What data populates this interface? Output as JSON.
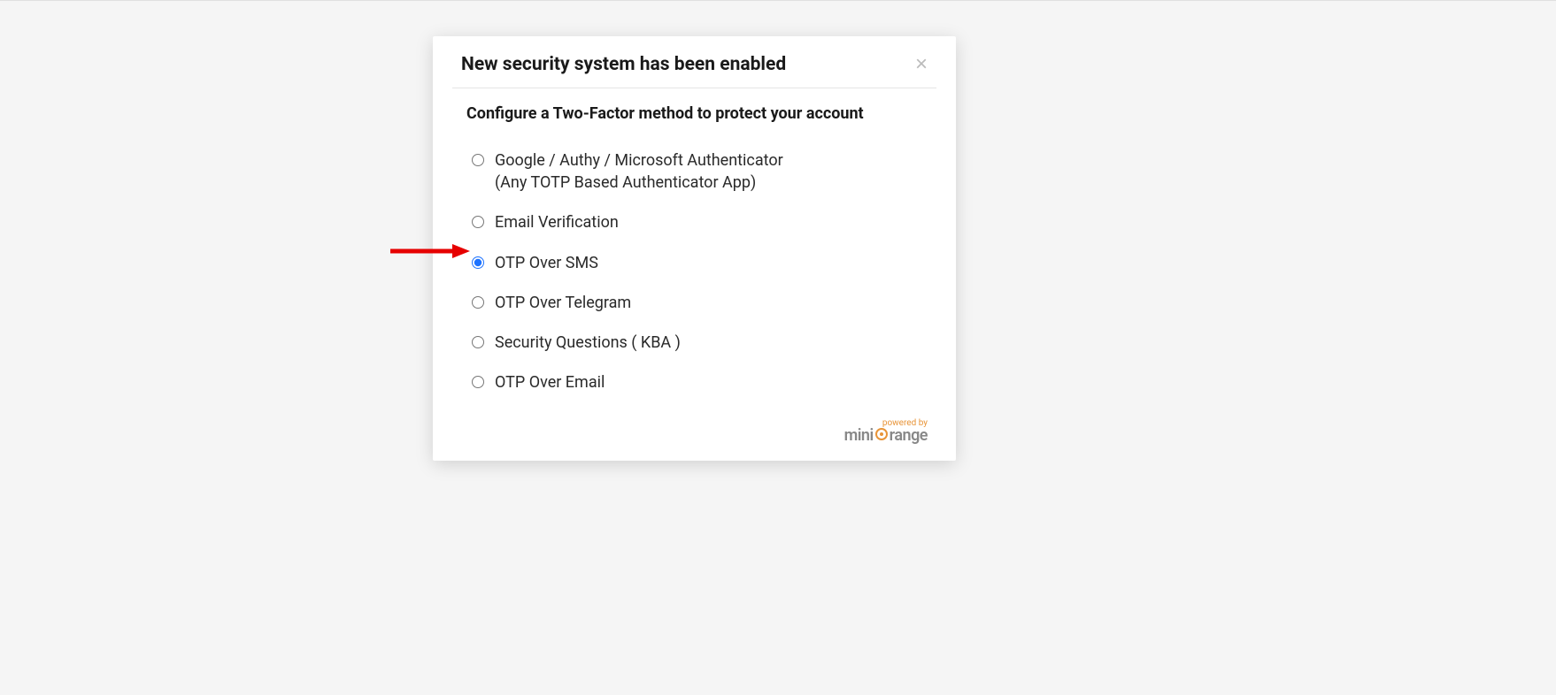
{
  "modal": {
    "title": "New security system has been enabled",
    "subtitle": "Configure a Two-Factor method to protect your account",
    "close_label": "×",
    "options": [
      {
        "label": "Google / Authy / Microsoft Authenticator",
        "sub": "(Any TOTP Based Authenticator App)",
        "selected": false
      },
      {
        "label": "Email Verification",
        "selected": false
      },
      {
        "label": "OTP Over SMS",
        "selected": true
      },
      {
        "label": "OTP Over Telegram",
        "selected": false
      },
      {
        "label": "Security Questions ( KBA )",
        "selected": false
      },
      {
        "label": "OTP Over Email",
        "selected": false
      }
    ]
  },
  "footer": {
    "powered_by": "powered by",
    "brand_part1": "mini",
    "brand_part2": "range"
  },
  "annotation": {
    "arrow_color": "#e60000"
  }
}
